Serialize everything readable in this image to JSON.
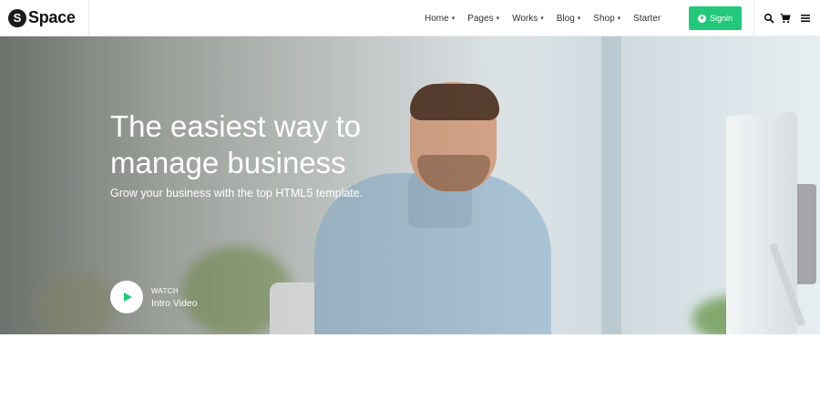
{
  "brand": {
    "badge": "S",
    "name": "Space"
  },
  "nav": {
    "items": [
      {
        "label": "Home",
        "dropdown": true
      },
      {
        "label": "Pages",
        "dropdown": true
      },
      {
        "label": "Works",
        "dropdown": true
      },
      {
        "label": "Blog",
        "dropdown": true
      },
      {
        "label": "Shop",
        "dropdown": true
      },
      {
        "label": "Starter",
        "dropdown": false
      }
    ],
    "signin_label": "Signin",
    "icons": [
      "search-icon",
      "cart-icon",
      "menu-icon"
    ]
  },
  "hero": {
    "title": "The easiest way to manage business",
    "subtitle": "Grow your business with the top HTML5 template.",
    "watch_label": "WATCH",
    "video_label": "Intro Video"
  },
  "colors": {
    "accent": "#22c97b",
    "dark": "#1b1b1b"
  }
}
